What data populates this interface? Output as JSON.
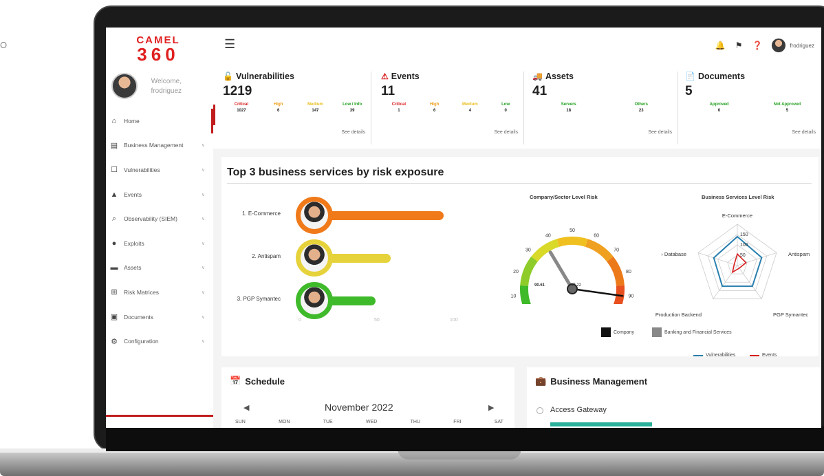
{
  "stray_text": "O",
  "app": {
    "logo_top": "CAMEL",
    "logo_bottom": "360"
  },
  "user": {
    "welcome": "Welcome,",
    "username": "frodriguez",
    "top_username": "frodriguez"
  },
  "sidebar": {
    "items": [
      {
        "label": "Home",
        "icon": "home-icon",
        "chevron": false
      },
      {
        "label": "Business Management",
        "icon": "briefcase-icon",
        "chevron": true
      },
      {
        "label": "Vulnerabilities",
        "icon": "unlock-icon",
        "chevron": true
      },
      {
        "label": "Events",
        "icon": "warning-icon",
        "chevron": true
      },
      {
        "label": "Observability (SIEM)",
        "icon": "magnifier-icon",
        "chevron": true
      },
      {
        "label": "Exploits",
        "icon": "bomb-icon",
        "chevron": true
      },
      {
        "label": "Assets",
        "icon": "truck-icon",
        "chevron": true
      },
      {
        "label": "Risk Matrices",
        "icon": "grid-icon",
        "chevron": true
      },
      {
        "label": "Documents",
        "icon": "document-icon",
        "chevron": true
      },
      {
        "label": "Configuration",
        "icon": "cogs-icon",
        "chevron": true
      }
    ]
  },
  "stats": {
    "see_details": "See details",
    "vulnerabilities": {
      "title": "Vulnerabilities",
      "count": "1219",
      "levels": [
        {
          "label": "Critical",
          "value": "1027",
          "color": "#d91f1f"
        },
        {
          "label": "High",
          "value": "6",
          "color": "#f0a020"
        },
        {
          "label": "Medium",
          "value": "147",
          "color": "#e8c020"
        },
        {
          "label": "Low / Info",
          "value": "39",
          "color": "#22a020"
        }
      ]
    },
    "events": {
      "title": "Events",
      "count": "11",
      "levels": [
        {
          "label": "Critical",
          "value": "1",
          "color": "#d91f1f"
        },
        {
          "label": "High",
          "value": "6",
          "color": "#f0a020"
        },
        {
          "label": "Medium",
          "value": "4",
          "color": "#e8c020"
        },
        {
          "label": "Low",
          "value": "0",
          "color": "#22a020"
        }
      ]
    },
    "assets": {
      "title": "Assets",
      "count": "41",
      "levels": [
        {
          "label": "Servers",
          "value": "18",
          "color": "#22a020"
        },
        {
          "label": "Others",
          "value": "23",
          "color": "#22a020"
        }
      ]
    },
    "documents": {
      "title": "Documents",
      "count": "5",
      "levels": [
        {
          "label": "Approved",
          "value": "0",
          "color": "#22a020"
        },
        {
          "label": "Not Approved",
          "value": "5",
          "color": "#22a020"
        }
      ]
    }
  },
  "risk": {
    "title": "Top 3 business services by risk exposure",
    "axis_ticks": [
      "0",
      "50",
      "100"
    ],
    "services": [
      {
        "label": "1. E-Commerce",
        "value": 85,
        "color": "#f07a1a"
      },
      {
        "label": "2. Antispam",
        "value": 50,
        "color": "#e6d23a"
      },
      {
        "label": "3. PGP Symantec",
        "value": 40,
        "color": "#3fba2a"
      }
    ],
    "gauge": {
      "title": "Company/Sector Level Risk",
      "ticks": [
        "0",
        "10",
        "20",
        "30",
        "40",
        "50",
        "60",
        "70",
        "80",
        "90",
        "100"
      ],
      "company_value": "90.61",
      "sector_value": "37.22",
      "legend": [
        {
          "label": "Company",
          "color": "#111111"
        },
        {
          "label": "Banking and Financial Services",
          "color": "#888888"
        }
      ]
    },
    "radar": {
      "title": "Business Services Level Risk",
      "axes": [
        "E-Commerce",
        "Antispam",
        "PGP Symantec",
        "Production Backend",
        "› Database"
      ],
      "ticks": [
        "150",
        "100",
        "50"
      ],
      "legend": [
        {
          "label": "Vulnerabilities",
          "color": "#2a7fae"
        },
        {
          "label": "Events",
          "color": "#d91f1f"
        }
      ]
    }
  },
  "schedule": {
    "title": "Schedule",
    "month": "November 2022",
    "days": [
      "SUN",
      "MON",
      "TUE",
      "WED",
      "THU",
      "FRI",
      "SAT"
    ]
  },
  "business_management": {
    "title": "Business Management",
    "item": "Access Gateway"
  }
}
